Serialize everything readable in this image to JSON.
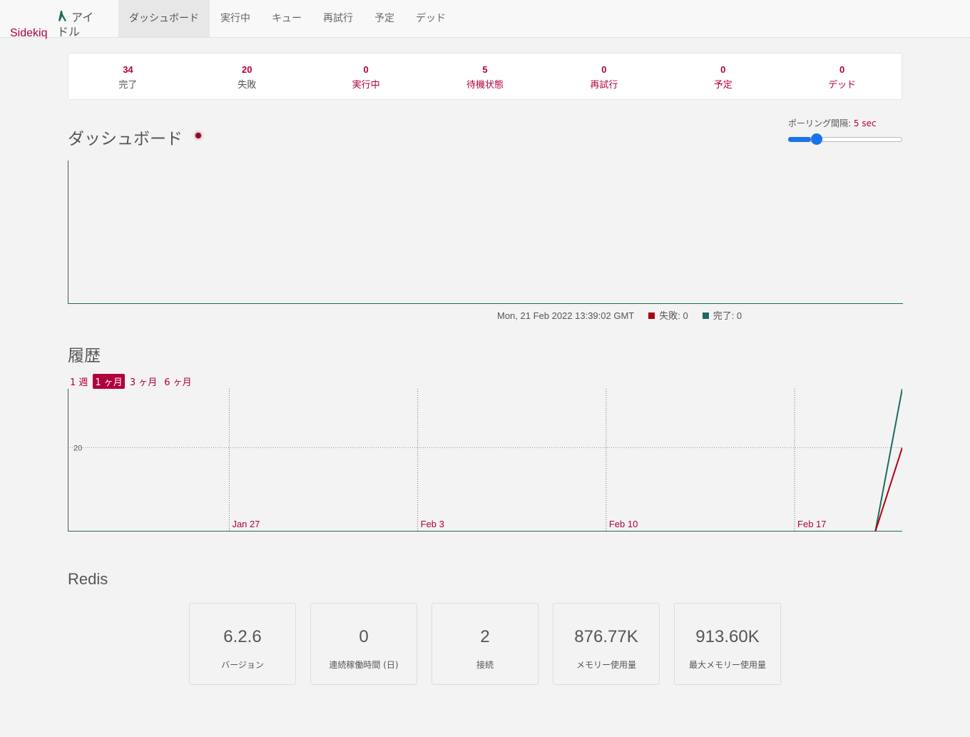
{
  "header": {
    "brand": "Sidekiq",
    "status": "アイドル",
    "nav": [
      "ダッシュボード",
      "実行中",
      "キュー",
      "再試行",
      "予定",
      "デッド"
    ]
  },
  "summary": [
    {
      "value": "34",
      "label": "完了"
    },
    {
      "value": "20",
      "label": "失敗"
    },
    {
      "value": "0",
      "label": "実行中"
    },
    {
      "value": "5",
      "label": "待機状態"
    },
    {
      "value": "0",
      "label": "再試行"
    },
    {
      "value": "0",
      "label": "予定"
    },
    {
      "value": "0",
      "label": "デッド"
    }
  ],
  "dashboard": {
    "title": "ダッシュボード",
    "poll_label": "ポーリング間隔:",
    "poll_value": "5 sec",
    "poll_level_fraction": 0.2,
    "timestamp": "Mon, 21 Feb 2022 13:39:02 GMT",
    "failed_label": "失敗: 0",
    "processed_label": "完了: 0"
  },
  "history": {
    "title": "履歴",
    "ranges": [
      "1 週",
      "1 ヶ月",
      "3 ヶ月",
      "6 ヶ月"
    ],
    "active_range": 1
  },
  "chart_data": {
    "type": "line",
    "x_ticks": [
      "Jan 27",
      "Feb 3",
      "Feb 10",
      "Feb 17"
    ],
    "y_ticks": [
      20
    ],
    "x_range": [
      "2022-01-21",
      "2022-02-21"
    ],
    "ylim": [
      0,
      34
    ],
    "grid": true,
    "series": [
      {
        "name": "完了",
        "color": "#1d6b62",
        "x": [
          "2022-02-20",
          "2022-02-21"
        ],
        "values": [
          0,
          34
        ]
      },
      {
        "name": "失敗",
        "color": "#af0014",
        "x": [
          "2022-02-20",
          "2022-02-21"
        ],
        "values": [
          0,
          20
        ]
      }
    ]
  },
  "redis": {
    "title": "Redis",
    "stats": [
      {
        "value": "6.2.6",
        "label": "バージョン"
      },
      {
        "value": "0",
        "label": "連続稼働時間 (日)"
      },
      {
        "value": "2",
        "label": "接続"
      },
      {
        "value": "876.77K",
        "label": "メモリー使用量"
      },
      {
        "value": "913.60K",
        "label": "最大メモリー使用量"
      }
    ]
  },
  "colors": {
    "accent": "#b1003e",
    "processed": "#1d6b62",
    "failed": "#af0014",
    "slider": "#1a73e8"
  }
}
